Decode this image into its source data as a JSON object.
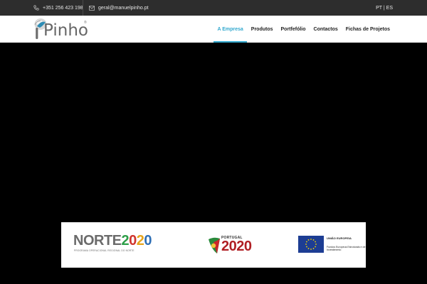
{
  "topbar": {
    "phone": "+351 256 423 198",
    "email": "geral@manuelpinho.pt",
    "languages": "PT | ES",
    "phone_icon": "phone-icon",
    "email_icon": "envelope-icon"
  },
  "header": {
    "logo_text": "Pinho",
    "logo_mark": "®",
    "nav": [
      {
        "label": "A Empresa",
        "active": true
      },
      {
        "label": "Produtos",
        "active": false
      },
      {
        "label": "Portfefólio",
        "active": false
      },
      {
        "label": "Contactos",
        "active": false
      },
      {
        "label": "Fichas de Projetos",
        "active": false
      }
    ]
  },
  "funding_banner": {
    "norte": {
      "text": "NORTE2020",
      "subtitle": "PROGRAMA OPERACIONAL REGIONAL DO NORTE"
    },
    "portugal": {
      "label": "PORTUGAL",
      "year": "2020"
    },
    "eu": {
      "title": "UNIÃO EUROPEIA",
      "subtitle": "Fundos Europeus Estruturais e de Investimento"
    }
  },
  "colors": {
    "accent": "#33a9cf",
    "topbar_bg": "#2d2d2d",
    "hero_bg": "#000000",
    "pt_red": "#b01f24",
    "eu_blue": "#1d3d93"
  }
}
